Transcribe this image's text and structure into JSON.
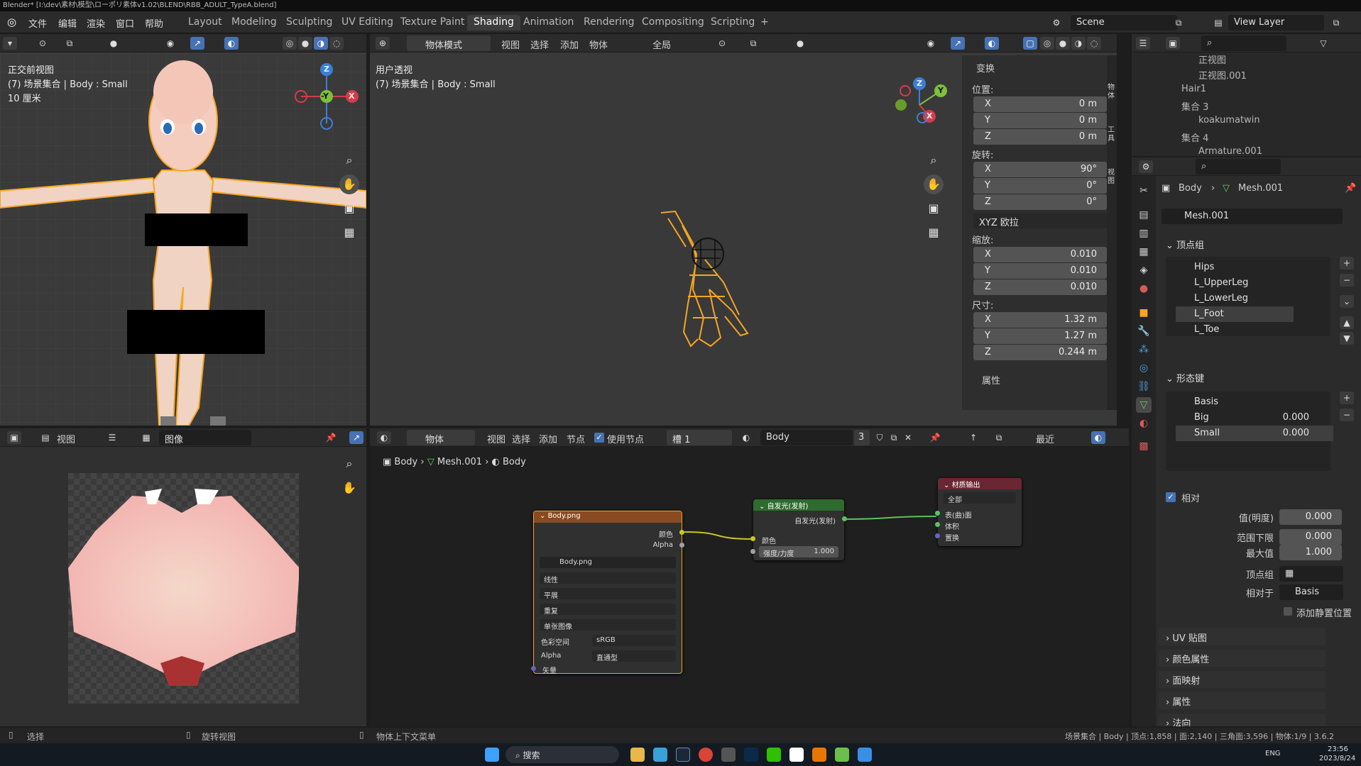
{
  "title_bar": {
    "text": "Blender* [I:\\dev\\素材\\模型\\ローポリ素体v1.02\\BLEND\\RBB_ADULT_TypeA.blend]"
  },
  "menu": {
    "items": [
      "文件",
      "编辑",
      "渲染",
      "窗口",
      "帮助"
    ]
  },
  "workspaces": {
    "tabs": [
      "Layout",
      "Modeling",
      "Sculpting",
      "UV Editing",
      "Texture Paint",
      "Shading",
      "Animation",
      "Rendering",
      "Compositing",
      "Scripting"
    ],
    "active": "Shading",
    "add_symbol": "+"
  },
  "scene": {
    "label": "Scene",
    "view_layer": "View Layer"
  },
  "left_viewport": {
    "view_name": "正交前视图",
    "collection": "(7) 场景集合 | Body : Small",
    "scale_text": "10 厘米",
    "gizmo": {
      "z": "Z",
      "y": "-Y",
      "x": "X"
    }
  },
  "main_viewport": {
    "header": {
      "mode": "物体模式",
      "menus": [
        "视图",
        "选择",
        "添加",
        "物体"
      ],
      "orientation": "全局"
    },
    "view_name": "用户透视",
    "collection": "(7) 场景集合 | Body : Small",
    "gizmo": {
      "z": "Z",
      "y": "Y",
      "x": "X"
    }
  },
  "transform_panel": {
    "title": "变换",
    "location_label": "位置:",
    "location": [
      {
        "axis": "X",
        "value": "0 m"
      },
      {
        "axis": "Y",
        "value": "0 m"
      },
      {
        "axis": "Z",
        "value": "0 m"
      }
    ],
    "rotation_label": "旋转:",
    "rotation": [
      {
        "axis": "X",
        "value": "90°"
      },
      {
        "axis": "Y",
        "value": "0°"
      },
      {
        "axis": "Z",
        "value": "0°"
      }
    ],
    "rotation_mode": "XYZ 欧拉",
    "scale_label": "缩放:",
    "scale": [
      {
        "axis": "X",
        "value": "0.010"
      },
      {
        "axis": "Y",
        "value": "0.010"
      },
      {
        "axis": "Z",
        "value": "0.010"
      }
    ],
    "dimensions_label": "尺寸:",
    "dimensions": [
      {
        "axis": "X",
        "value": "1.32 m"
      },
      {
        "axis": "Y",
        "value": "1.27 m"
      },
      {
        "axis": "Z",
        "value": "0.244 m"
      }
    ],
    "properties_label": "属性"
  },
  "sidebar_tabs": [
    "物体",
    "工具",
    "视图"
  ],
  "outliner": {
    "rows": [
      {
        "name": "正视图",
        "indent": 3
      },
      {
        "name": "正视图.001",
        "indent": 3
      },
      {
        "name": "Hair1",
        "indent": 2
      },
      {
        "name": "集合 3",
        "indent": 1
      },
      {
        "name": "koakumatwin",
        "indent": 2
      },
      {
        "name": "集合 4",
        "indent": 1
      },
      {
        "name": "Armature.001",
        "indent": 2
      }
    ]
  },
  "properties": {
    "breadcrumb": {
      "object": "Body",
      "mesh": "Mesh.001"
    },
    "mesh_name": "Mesh.001",
    "vertex_groups": {
      "title": "顶点组",
      "items": [
        "Hips",
        "L_UpperLeg",
        "L_LowerLeg",
        "L_Foot",
        "L_Toe"
      ],
      "selected": "L_Foot"
    },
    "shape_keys": {
      "title": "形态键",
      "items": [
        {
          "name": "Basis",
          "value": ""
        },
        {
          "name": "Big",
          "value": "0.000"
        },
        {
          "name": "Small",
          "value": "0.000"
        }
      ]
    },
    "relative": {
      "label": "相对",
      "fields": [
        {
          "label": "值(明度)",
          "value": "0.000"
        },
        {
          "label": "范围下限",
          "value": "0.000"
        },
        {
          "label": "最大值",
          "value": "1.000"
        }
      ],
      "vertex_group_label": "顶点组",
      "relative_to_label": "相对于",
      "relative_to": "Basis",
      "add_rest_label": "添加静置位置"
    },
    "sections": [
      "UV 贴图",
      "颜色属性",
      "面映射",
      "属性",
      "法向"
    ]
  },
  "image_editor": {
    "header_view": "视图",
    "header_image": "图像"
  },
  "node_editor": {
    "header": {
      "type": "物体",
      "menus": [
        "视图",
        "选择",
        "添加",
        "节点"
      ],
      "use_nodes": "使用节点",
      "slot": "槽 1",
      "material": "Body",
      "users": "3",
      "recent": "最近"
    },
    "breadcrumb": [
      "Body",
      "Mesh.001",
      "Body"
    ],
    "image_node": {
      "title": "Body.png",
      "out_color": "颜色",
      "out_alpha": "Alpha",
      "image": "Body.png",
      "options": [
        "线性",
        "平展",
        "重复",
        "单张图像"
      ],
      "colorspace_label": "色彩空间",
      "colorspace": "sRGB",
      "alpha_label": "Alpha",
      "alpha": "直通型",
      "vector": "矢量"
    },
    "emission_node": {
      "title": "自发光(发射)",
      "out": "自发光(发射)",
      "in_color": "颜色",
      "strength_label": "强度/力度",
      "strength": "1.000"
    },
    "output_node": {
      "title": "材质输出",
      "target": "全部",
      "surface": "表(曲)面",
      "volume": "体积",
      "displacement": "置换"
    }
  },
  "status_bar": {
    "left_select": "选择",
    "left_rotate": "旋转视图",
    "context_menu": "物体上下文菜单",
    "stats": "场景集合 | Body | 顶点:1,858 | 面:2,140 | 三角面:3,596 | 物体:1/9 | 3.6.2"
  },
  "taskbar": {
    "search": "搜索",
    "lang": "ENG",
    "time": "23:56",
    "date": "2023/8/24"
  },
  "colors": {
    "accent_blue": "#4772b3",
    "selection_orange": "#f5a623",
    "image_node": "#8a4a1f",
    "emission_node": "#2e6b2e",
    "output_node": "#6b2633"
  }
}
